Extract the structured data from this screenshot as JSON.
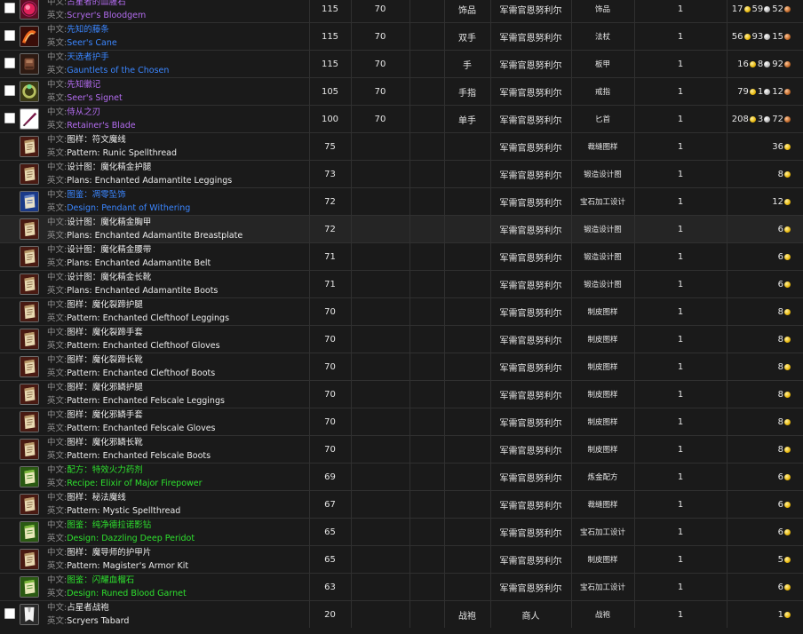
{
  "labels": {
    "cn": "中文:",
    "en": "英文:"
  },
  "rows": [
    {
      "icon": "bloodgem-icon",
      "has_checkbox": true,
      "quality": "epic",
      "cn": "占星者的血腥石",
      "en": "Scryer's Bloodgem",
      "item_level": "115",
      "req_level": "70",
      "type": "饰品",
      "vendor": "军需官恩努利尔",
      "subtype": "饰品",
      "qty": "1",
      "gold": "17",
      "silver": "59",
      "copper": "52"
    },
    {
      "icon": "cane-icon",
      "has_checkbox": true,
      "quality": "rare",
      "cn": "先知的藤条",
      "en": "Seer's Cane",
      "item_level": "115",
      "req_level": "70",
      "type": "双手",
      "vendor": "军需官恩努利尔",
      "subtype": "法杖",
      "qty": "1",
      "gold": "56",
      "silver": "93",
      "copper": "15"
    },
    {
      "icon": "gauntlets-icon",
      "has_checkbox": true,
      "quality": "rare",
      "cn": "天选者护手",
      "en": "Gauntlets of the Chosen",
      "item_level": "115",
      "req_level": "70",
      "type": "手",
      "vendor": "军需官恩努利尔",
      "subtype": "板甲",
      "qty": "1",
      "gold": "16",
      "silver": "8",
      "copper": "92"
    },
    {
      "icon": "signet-icon",
      "has_checkbox": true,
      "quality": "epic",
      "cn": "先知徽记",
      "en": "Seer's Signet",
      "item_level": "105",
      "req_level": "70",
      "type": "手指",
      "vendor": "军需官恩努利尔",
      "subtype": "戒指",
      "qty": "1",
      "gold": "79",
      "silver": "1",
      "copper": "12"
    },
    {
      "icon": "blade-icon",
      "has_checkbox": true,
      "quality": "epic",
      "cn": "侍从之刃",
      "en": "Retainer's Blade",
      "item_level": "100",
      "req_level": "70",
      "type": "单手",
      "vendor": "军需官恩努利尔",
      "subtype": "匕首",
      "qty": "1",
      "gold": "208",
      "silver": "3",
      "copper": "72"
    },
    {
      "icon": "scroll-icon",
      "has_checkbox": false,
      "quality": "com",
      "cn": "图样：符文魔线",
      "en": "Pattern: Runic Spellthread",
      "item_level": "75",
      "req_level": "",
      "type": "",
      "vendor": "军需官恩努利尔",
      "subtype": "裁缝图样",
      "qty": "1",
      "gold": "36",
      "silver": "",
      "copper": ""
    },
    {
      "icon": "scroll-icon",
      "has_checkbox": false,
      "quality": "com",
      "cn": "设计图：魔化精金护腿",
      "en": "Plans: Enchanted Adamantite Leggings",
      "item_level": "73",
      "req_level": "",
      "type": "",
      "vendor": "军需官恩努利尔",
      "subtype": "锻造设计图",
      "qty": "1",
      "gold": "8",
      "silver": "",
      "copper": ""
    },
    {
      "icon": "scroll-blue-icon",
      "has_checkbox": false,
      "quality": "rare",
      "cn": "图鉴：凋零坠饰",
      "en": "Design: Pendant of Withering",
      "item_level": "72",
      "req_level": "",
      "type": "",
      "vendor": "军需官恩努利尔",
      "subtype": "宝石加工设计",
      "qty": "1",
      "gold": "12",
      "silver": "",
      "copper": ""
    },
    {
      "icon": "scroll-icon",
      "has_checkbox": false,
      "quality": "com",
      "cn": "设计图：魔化精金胸甲",
      "en": "Plans: Enchanted Adamantite Breastplate",
      "item_level": "72",
      "req_level": "",
      "type": "",
      "vendor": "军需官恩努利尔",
      "subtype": "锻造设计图",
      "qty": "1",
      "gold": "6",
      "silver": "",
      "copper": "",
      "highlight": true
    },
    {
      "icon": "scroll-icon",
      "has_checkbox": false,
      "quality": "com",
      "cn": "设计图：魔化精金腰带",
      "en": "Plans: Enchanted Adamantite Belt",
      "item_level": "71",
      "req_level": "",
      "type": "",
      "vendor": "军需官恩努利尔",
      "subtype": "锻造设计图",
      "qty": "1",
      "gold": "6",
      "silver": "",
      "copper": ""
    },
    {
      "icon": "scroll-icon",
      "has_checkbox": false,
      "quality": "com",
      "cn": "设计图：魔化精金长靴",
      "en": "Plans: Enchanted Adamantite Boots",
      "item_level": "71",
      "req_level": "",
      "type": "",
      "vendor": "军需官恩努利尔",
      "subtype": "锻造设计图",
      "qty": "1",
      "gold": "6",
      "silver": "",
      "copper": ""
    },
    {
      "icon": "scroll-icon",
      "has_checkbox": false,
      "quality": "com",
      "cn": "图样：魔化裂蹄护腿",
      "en": "Pattern: Enchanted Clefthoof Leggings",
      "item_level": "70",
      "req_level": "",
      "type": "",
      "vendor": "军需官恩努利尔",
      "subtype": "制皮图样",
      "qty": "1",
      "gold": "8",
      "silver": "",
      "copper": ""
    },
    {
      "icon": "scroll-icon",
      "has_checkbox": false,
      "quality": "com",
      "cn": "图样：魔化裂蹄手套",
      "en": "Pattern: Enchanted Clefthoof Gloves",
      "item_level": "70",
      "req_level": "",
      "type": "",
      "vendor": "军需官恩努利尔",
      "subtype": "制皮图样",
      "qty": "1",
      "gold": "8",
      "silver": "",
      "copper": ""
    },
    {
      "icon": "scroll-icon",
      "has_checkbox": false,
      "quality": "com",
      "cn": "图样：魔化裂蹄长靴",
      "en": "Pattern: Enchanted Clefthoof Boots",
      "item_level": "70",
      "req_level": "",
      "type": "",
      "vendor": "军需官恩努利尔",
      "subtype": "制皮图样",
      "qty": "1",
      "gold": "8",
      "silver": "",
      "copper": ""
    },
    {
      "icon": "scroll-icon",
      "has_checkbox": false,
      "quality": "com",
      "cn": "图样：魔化邪鳞护腿",
      "en": "Pattern: Enchanted Felscale Leggings",
      "item_level": "70",
      "req_level": "",
      "type": "",
      "vendor": "军需官恩努利尔",
      "subtype": "制皮图样",
      "qty": "1",
      "gold": "8",
      "silver": "",
      "copper": ""
    },
    {
      "icon": "scroll-icon",
      "has_checkbox": false,
      "quality": "com",
      "cn": "图样：魔化邪鳞手套",
      "en": "Pattern: Enchanted Felscale Gloves",
      "item_level": "70",
      "req_level": "",
      "type": "",
      "vendor": "军需官恩努利尔",
      "subtype": "制皮图样",
      "qty": "1",
      "gold": "8",
      "silver": "",
      "copper": ""
    },
    {
      "icon": "scroll-icon",
      "has_checkbox": false,
      "quality": "com",
      "cn": "图样：魔化邪鳞长靴",
      "en": "Pattern: Enchanted Felscale Boots",
      "item_level": "70",
      "req_level": "",
      "type": "",
      "vendor": "军需官恩努利尔",
      "subtype": "制皮图样",
      "qty": "1",
      "gold": "8",
      "silver": "",
      "copper": ""
    },
    {
      "icon": "recipe-green-icon",
      "has_checkbox": false,
      "quality": "unc",
      "cn": "配方：特效火力药剂",
      "en": "Recipe: Elixir of Major Firepower",
      "item_level": "69",
      "req_level": "",
      "type": "",
      "vendor": "军需官恩努利尔",
      "subtype": "炼金配方",
      "qty": "1",
      "gold": "6",
      "silver": "",
      "copper": ""
    },
    {
      "icon": "scroll-icon",
      "has_checkbox": false,
      "quality": "com",
      "cn": "图样：秘法魔线",
      "en": "Pattern: Mystic Spellthread",
      "item_level": "67",
      "req_level": "",
      "type": "",
      "vendor": "军需官恩努利尔",
      "subtype": "裁缝图样",
      "qty": "1",
      "gold": "6",
      "silver": "",
      "copper": ""
    },
    {
      "icon": "recipe-green-icon",
      "has_checkbox": false,
      "quality": "unc",
      "cn": "图鉴：纯净德拉诺影钻",
      "en": "Design: Dazzling Deep Peridot",
      "item_level": "65",
      "req_level": "",
      "type": "",
      "vendor": "军需官恩努利尔",
      "subtype": "宝石加工设计",
      "qty": "1",
      "gold": "6",
      "silver": "",
      "copper": ""
    },
    {
      "icon": "scroll-icon",
      "has_checkbox": false,
      "quality": "com",
      "cn": "图样：魔导师的护甲片",
      "en": "Pattern: Magister's Armor Kit",
      "item_level": "65",
      "req_level": "",
      "type": "",
      "vendor": "军需官恩努利尔",
      "subtype": "制皮图样",
      "qty": "1",
      "gold": "5",
      "silver": "",
      "copper": ""
    },
    {
      "icon": "recipe-green-icon",
      "has_checkbox": false,
      "quality": "unc",
      "cn": "图鉴：闪耀血榴石",
      "en": "Design: Runed Blood Garnet",
      "item_level": "63",
      "req_level": "",
      "type": "",
      "vendor": "军需官恩努利尔",
      "subtype": "宝石加工设计",
      "qty": "1",
      "gold": "6",
      "silver": "",
      "copper": ""
    },
    {
      "icon": "tabard-icon",
      "has_checkbox": true,
      "quality": "com",
      "cn": "占星者战袍",
      "en": "Scryers Tabard",
      "item_level": "20",
      "req_level": "",
      "type": "战袍",
      "vendor": "商人",
      "subtype": "战袍",
      "qty": "1",
      "gold": "1",
      "silver": "",
      "copper": ""
    }
  ]
}
